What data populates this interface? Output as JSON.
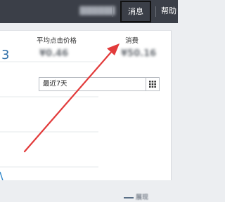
{
  "topbar": {
    "user_name": "▓▓▓▓▓▓",
    "messages_label": "消息",
    "help_label": "帮助"
  },
  "stats": {
    "edge_value": "3",
    "avg_click_price_label": "平均点击价格",
    "avg_click_price_value": "¥0.46",
    "cost_label": "消费",
    "cost_value": "¥50.16"
  },
  "date_range": {
    "selected": "最近7天"
  },
  "legend": {
    "label": "展现"
  },
  "colors": {
    "topbar_bg": "#3b3f48",
    "series_line": "#2e86c9",
    "annotation_arrow": "#e23b3b"
  },
  "icons": {
    "calendar": "grid-calendar-icon"
  }
}
